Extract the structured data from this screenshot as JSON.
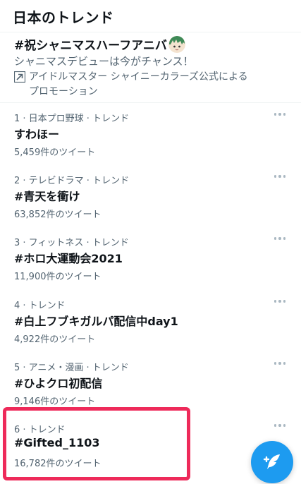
{
  "header": {
    "title": "日本のトレンド"
  },
  "promoted": {
    "hashtag": "#祝シャニマスハーフアニバ",
    "description": "シャニマスデビューは今がチャンス！",
    "promoted_by_line1": "アイドルマスター シャイニーカラーズ公式による",
    "promoted_by_line2": "プロモーション"
  },
  "trends": [
    {
      "category": "1 · 日本プロ野球 · トレンド",
      "name": "すわほー",
      "tweets": "5,459件のツイート"
    },
    {
      "category": "2 · テレビドラマ · トレンド",
      "name": "#青天を衝け",
      "tweets": "63,852件のツイート"
    },
    {
      "category": "3 · フィットネス · トレンド",
      "name": "#ホロ大運動会2021",
      "tweets": "11,900件のツイート"
    },
    {
      "category": "4 · トレンド",
      "name": "#白上フブキガルパ配信中day1",
      "tweets": "4,922件のツイート"
    },
    {
      "category": "5 · アニメ・漫画 · トレンド",
      "name": "#ひよクロ初配信",
      "tweets": "9,146件のツイート"
    },
    {
      "category": "6 · トレンド",
      "name": "#Gifted_1103",
      "tweets": "16,782件のツイート"
    }
  ],
  "icons": {
    "promoted": "promoted-arrow-icon",
    "more": "more-dots-icon",
    "compose": "compose-tweet-icon"
  },
  "colors": {
    "accent": "#1d9bf0",
    "highlight": "#ee2a5a",
    "secondary_text": "#536471"
  }
}
